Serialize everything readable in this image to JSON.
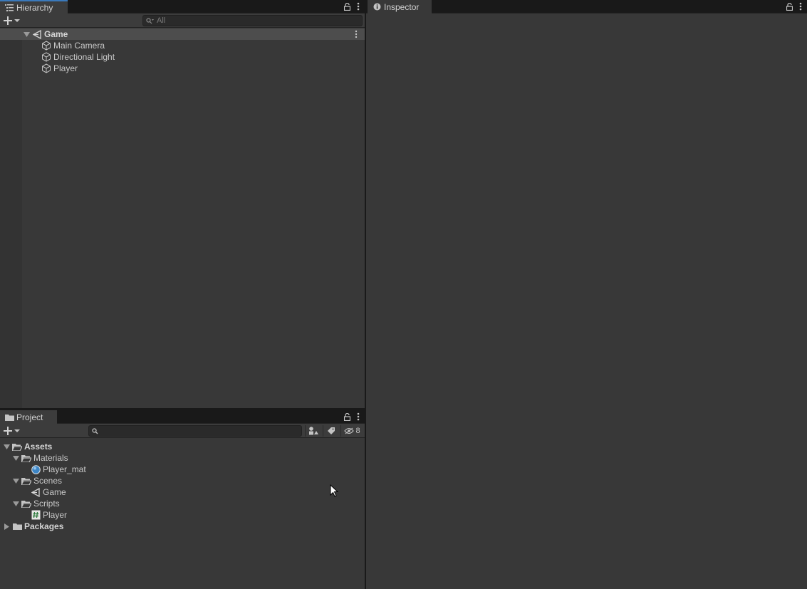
{
  "hierarchy": {
    "tab_label": "Hierarchy",
    "search_placeholder": "All",
    "scene": {
      "name": "Game"
    },
    "objects": [
      {
        "label": "Main Camera",
        "icon": "cube-icon"
      },
      {
        "label": "Directional Light",
        "icon": "cube-icon"
      },
      {
        "label": "Player",
        "icon": "cube-icon"
      }
    ]
  },
  "inspector": {
    "tab_label": "Inspector"
  },
  "project": {
    "tab_label": "Project",
    "search_placeholder": "",
    "hidden_count": "8",
    "tree": {
      "assets": "Assets",
      "materials": "Materials",
      "player_mat": "Player_mat",
      "scenes": "Scenes",
      "game_scene": "Game",
      "scripts": "Scripts",
      "player_script": "Player",
      "packages": "Packages"
    }
  },
  "colors": {
    "panel_bg": "#383838",
    "tabbar_bg": "#191919",
    "accent": "#3a79bb",
    "scene_row_bg": "#4d4d4d"
  }
}
